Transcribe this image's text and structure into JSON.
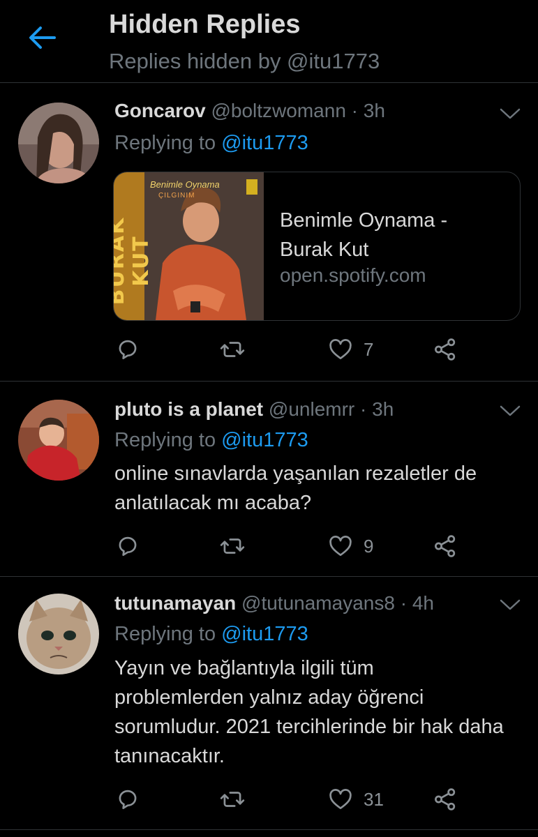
{
  "header": {
    "title": "Hidden Replies",
    "subtitle": "Replies hidden by @itu1773"
  },
  "colors": {
    "accent": "#1d9bf0",
    "muted": "#6e767d",
    "background": "#000000",
    "divider": "#2f3336"
  },
  "tweets": [
    {
      "name": "Goncarov",
      "handle": "@boltzwomann",
      "time": "3h",
      "replying_label": "Replying to",
      "replying_to": "@itu1773",
      "card": {
        "image_text_artist": "BURAK KUT",
        "image_text_album": "Benimle Oynama",
        "image_text_sub": "ÇILGINIM",
        "title": "Benimle Oynama - Burak Kut",
        "domain": "open.spotify.com"
      },
      "likes": "7"
    },
    {
      "name": "pluto is a planet",
      "handle": "@unlemrr",
      "time": "3h",
      "replying_label": "Replying to",
      "replying_to": "@itu1773",
      "text": "online sınavlarda yaşanılan rezaletler de anlatılacak mı acaba?",
      "likes": "9"
    },
    {
      "name": "tutunamayan",
      "handle": "@tutunamayans8",
      "time": "4h",
      "replying_label": "Replying to",
      "replying_to": "@itu1773",
      "text": "Yayın ve bağlantıyla ilgili tüm problemlerden yalnız aday  öğrenci sorumludur. 2021 tercihlerinde bir hak daha tanınacaktır.",
      "likes": "31"
    }
  ],
  "icons": {
    "back": "arrow-left-icon",
    "reply": "reply-icon",
    "retweet": "retweet-icon",
    "like": "heart-icon",
    "share": "share-icon",
    "more": "chevron-down-icon"
  }
}
